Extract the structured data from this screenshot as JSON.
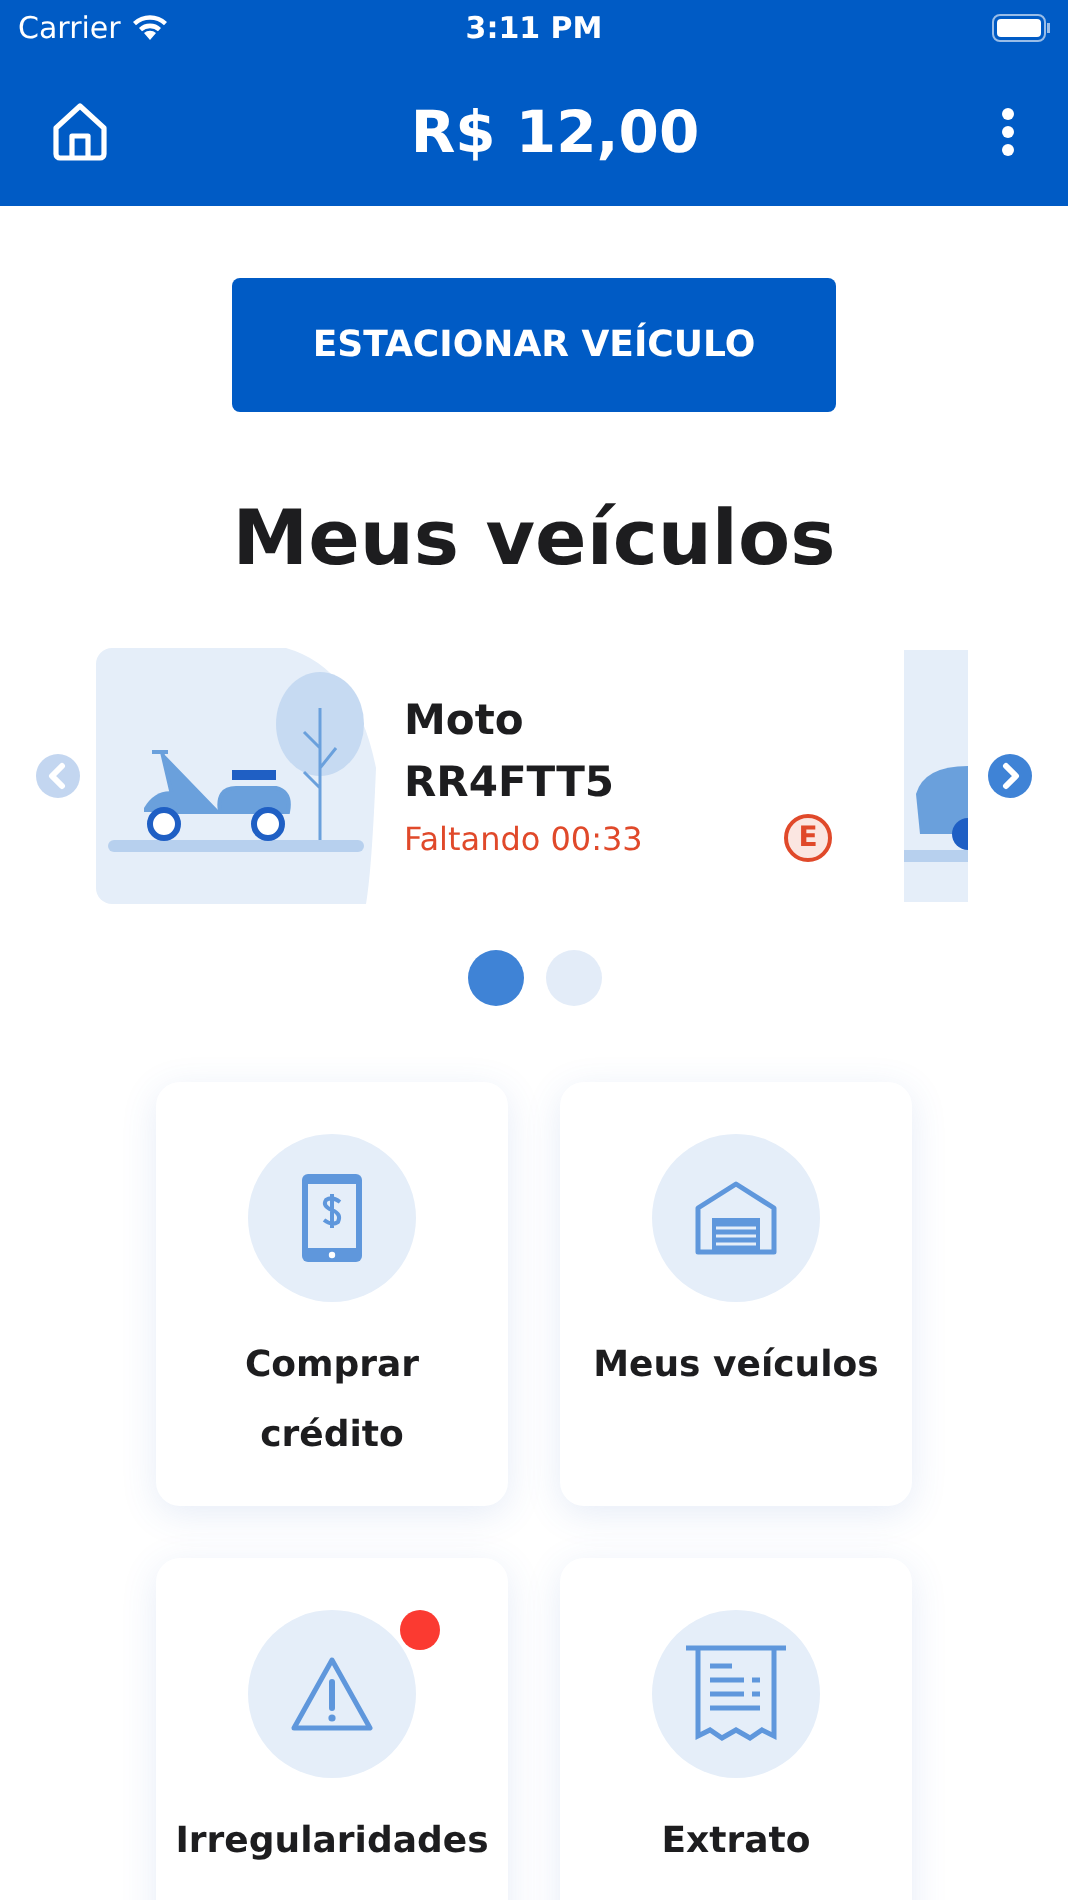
{
  "status_bar": {
    "carrier": "Carrier",
    "time": "3:11 PM"
  },
  "header": {
    "balance": "R$ 12,00"
  },
  "park_button": "ESTACIONAR VEÍCULO",
  "section_title": "Meus veículos",
  "carousel": {
    "prev_disabled": true,
    "next_disabled": false,
    "vehicles": [
      {
        "kind": "moto",
        "type": "Moto",
        "plate": "RR4FTT5",
        "remaining": "Faltando 00:33",
        "badge": "E"
      }
    ],
    "dots": [
      {
        "selected": true
      },
      {
        "selected": false
      }
    ]
  },
  "tiles": [
    {
      "kind": "phone",
      "label": "Comprar crédito",
      "alert": false
    },
    {
      "kind": "garage",
      "label": "Meus veículos",
      "alert": false
    },
    {
      "kind": "warning",
      "label": "Irregularidades",
      "alert": true
    },
    {
      "kind": "receipt",
      "label": "Extrato",
      "alert": false
    }
  ]
}
